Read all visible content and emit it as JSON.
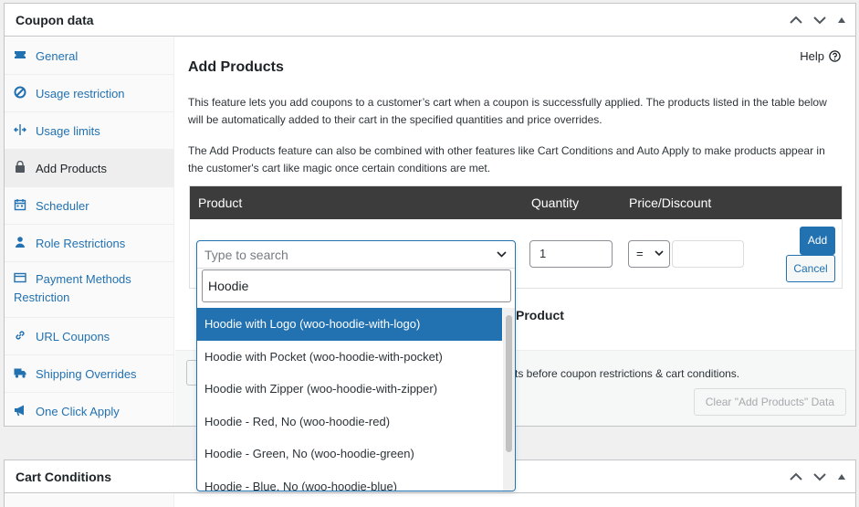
{
  "coupon_panel": {
    "title": "Coupon data"
  },
  "sidebar": {
    "items": [
      {
        "label": "General",
        "icon": "ticket-icon"
      },
      {
        "label": "Usage restriction",
        "icon": "block-icon"
      },
      {
        "label": "Usage limits",
        "icon": "arrows-icon"
      },
      {
        "label": "Add Products",
        "icon": "bag-icon",
        "active": true
      },
      {
        "label": "Scheduler",
        "icon": "calendar-icon"
      },
      {
        "label": "Role Restrictions",
        "icon": "user-icon"
      },
      {
        "label": "Payment Methods Restriction",
        "icon": "payment-icon"
      },
      {
        "label": "URL Coupons",
        "icon": "link-icon"
      },
      {
        "label": "Shipping Overrides",
        "icon": "truck-icon"
      },
      {
        "label": "One Click Apply",
        "icon": "megaphone-icon"
      }
    ]
  },
  "main": {
    "help_label": "Help",
    "title": "Add Products",
    "desc1": "This feature lets you add coupons to a customer’s cart when a coupon is successfully applied. The products listed in the table below will be automatically added to their cart in the specified quantities and price overrides.",
    "desc2": "The Add Products feature can also be combined with other features like Cart Conditions and Auto Apply to make products appear in the customer's cart like magic once certain conditions are met.",
    "table": {
      "col_product": "Product",
      "col_quantity": "Quantity",
      "col_price": "Price/Discount",
      "quantity_value": "1",
      "price_operator": "=",
      "add_label": "Add",
      "cancel_label": "Cancel"
    },
    "add_product_link": "Product",
    "lower_text": "ts before coupon restrictions & cart conditions.",
    "clear_label": "Clear \"Add Products\" Data"
  },
  "dropdown": {
    "placeholder": "Type to search",
    "search_value": "Hoodie",
    "options": [
      "Hoodie with Logo (woo-hoodie-with-logo)",
      "Hoodie with Pocket (woo-hoodie-with-pocket)",
      "Hoodie with Zipper (woo-hoodie-with-zipper)",
      "Hoodie - Red, No (woo-hoodie-red)",
      "Hoodie - Green, No (woo-hoodie-green)",
      "Hoodie - Blue, No (woo-hoodie-blue)"
    ],
    "highlighted_index": 0
  },
  "cart_panel": {
    "title": "Cart Conditions"
  },
  "colors": {
    "accent": "#2271b1",
    "table_header": "#3c3c3c",
    "text": "#1d2327"
  }
}
